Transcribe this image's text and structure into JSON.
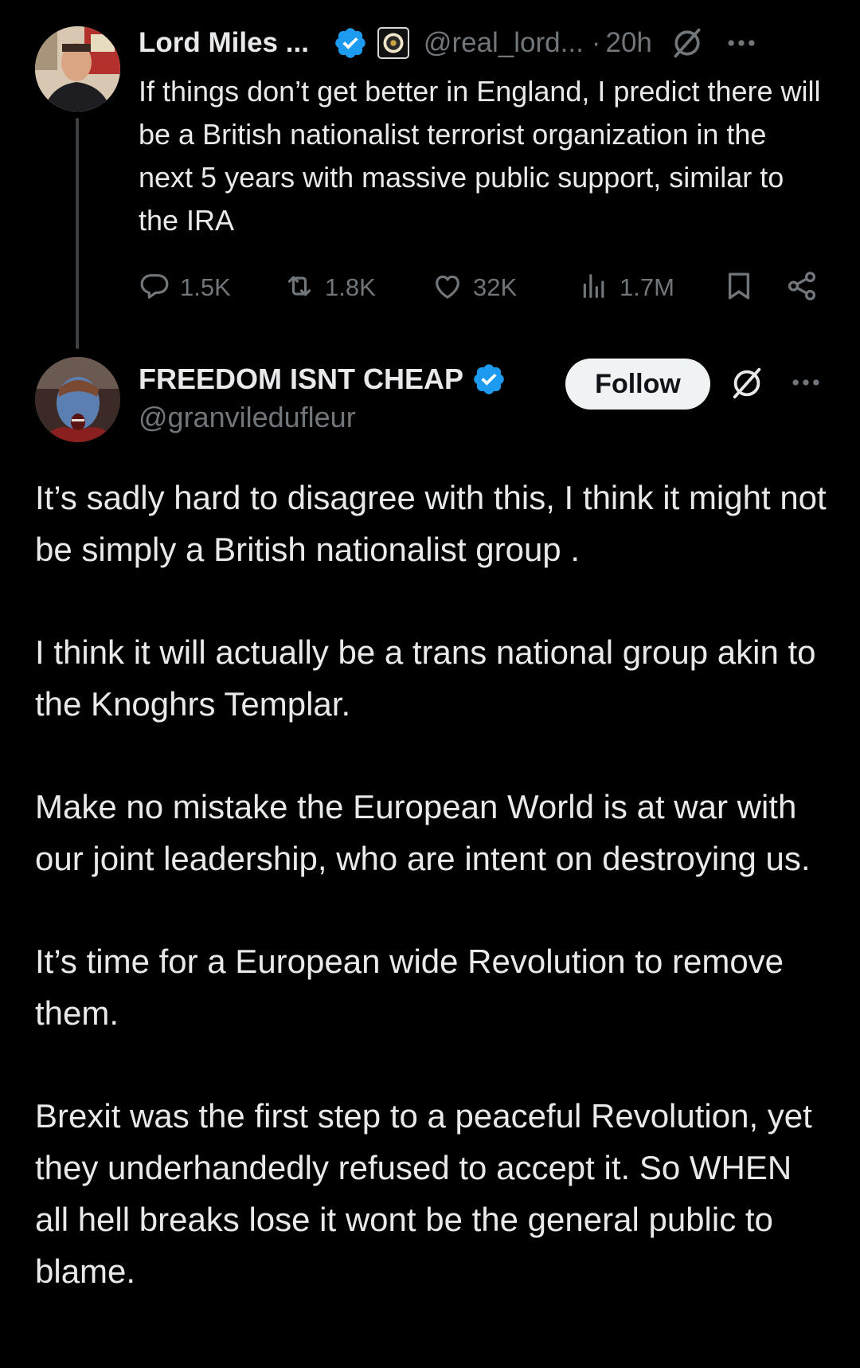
{
  "colors": {
    "background": "#000000",
    "text_primary": "#e7e9ea",
    "text_secondary": "#71767b",
    "verified_blue": "#1d9bf0",
    "follow_bg": "#eff3f4"
  },
  "tweet1": {
    "author_name": "Lord Miles ...",
    "handle": "@real_lord...",
    "separator": "·",
    "time": "20h",
    "text": "If things don’t get better in England, I predict there will be a British nationalist terrorist organization in the next 5 years with massive public support, similar to the IRA",
    "stats": {
      "replies": "1.5K",
      "reposts": "1.8K",
      "likes": "32K",
      "views": "1.7M"
    },
    "icons": [
      "avatar",
      "verified-icon",
      "affiliate-badge-icon",
      "grok-icon",
      "more-icon",
      "reply-icon",
      "repost-icon",
      "like-icon",
      "views-icon",
      "bookmark-icon",
      "share-icon"
    ]
  },
  "tweet2": {
    "author_name": "FREEDOM ISNT CHEAP",
    "handle": "@granviledufleur",
    "follow_label": "Follow",
    "paragraphs": [
      "It’s sadly hard to disagree with this,  I think it might not be simply a British nationalist group .",
      "I think it will actually be a trans national group akin to the Knoghrs Templar.",
      "Make no mistake the European World is at war with our joint leadership, who are intent on destroying us.",
      "It’s time for a European wide Revolution to remove them.",
      "Brexit was the first step to a peaceful Revolution, yet they underhandedly refused to accept it.  So WHEN all hell breaks lose it wont be the general public to blame."
    ],
    "icons": [
      "avatar",
      "verified-icon",
      "grok-icon",
      "more-icon"
    ]
  }
}
